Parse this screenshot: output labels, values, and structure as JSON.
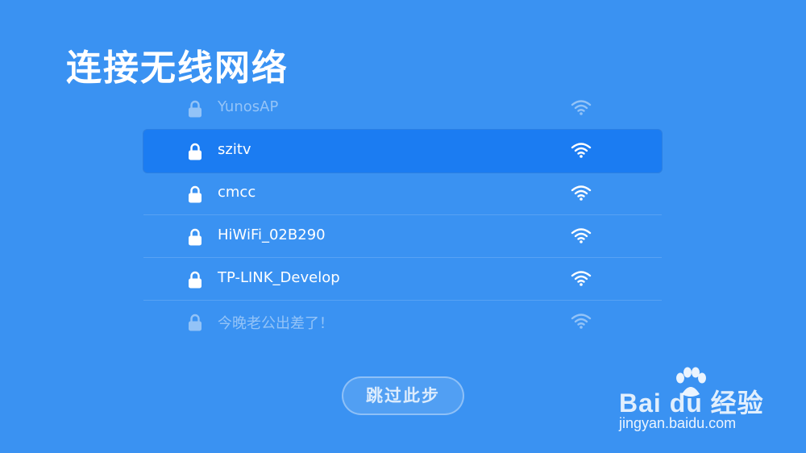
{
  "page": {
    "title": "连接无线网络"
  },
  "networks": [
    {
      "ssid": "YunosAP",
      "secured": true,
      "state": "dim"
    },
    {
      "ssid": "szitv",
      "secured": true,
      "state": "selected"
    },
    {
      "ssid": "cmcc",
      "secured": true,
      "state": "normal"
    },
    {
      "ssid": "HiWiFi_02B290",
      "secured": true,
      "state": "normal"
    },
    {
      "ssid": "TP-LINK_Develop",
      "secured": true,
      "state": "normal"
    },
    {
      "ssid": "今晚老公出差了！",
      "secured": true,
      "state": "dim"
    }
  ],
  "actions": {
    "skip_label": "跳过此步"
  },
  "watermark": {
    "brand": "Bai du 经验",
    "url": "jingyan.baidu.com"
  },
  "colors": {
    "background": "#3a92f2",
    "selected_row": "#1b7cf2",
    "text": "#ffffff"
  }
}
